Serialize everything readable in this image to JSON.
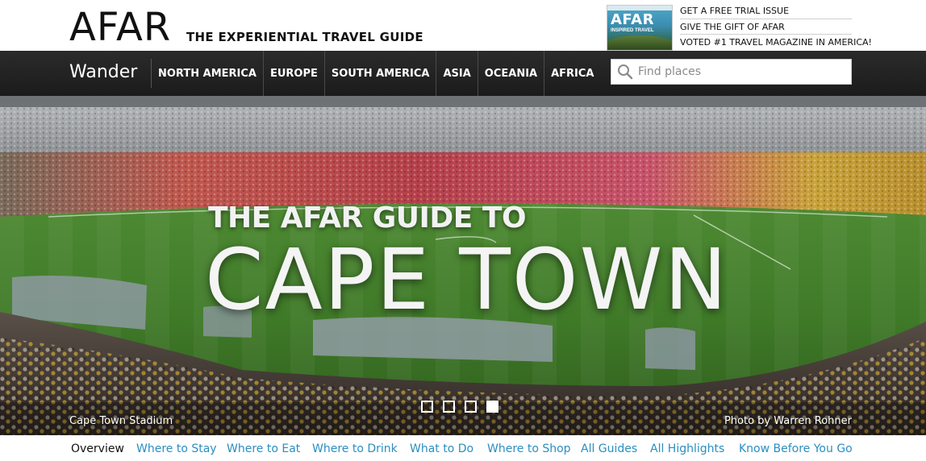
{
  "brand": {
    "logo": "AFAR",
    "tagline": "THE EXPERIENTIAL TRAVEL GUIDE",
    "magazine_logo": "AFAR",
    "magazine_sub": "INSPIRED TRAVEL"
  },
  "promos": [
    "GET A FREE TRIAL ISSUE",
    "GIVE THE GIFT OF AFAR",
    "VOTED #1 TRAVEL MAGAZINE IN AMERICA!"
  ],
  "nav": {
    "wander": "Wander",
    "regions": [
      "NORTH AMERICA",
      "EUROPE",
      "SOUTH AMERICA",
      "ASIA",
      "OCEANIA",
      "AFRICA"
    ],
    "search_placeholder": "Find places"
  },
  "hero": {
    "kicker": "THE AFAR GUIDE TO",
    "title": "CAPE TOWN",
    "caption_left": "Cape Town Stadium",
    "caption_right": "Photo by Warren Rohner",
    "slides": 4,
    "active_slide": 4
  },
  "subnav": [
    "Overview",
    "Where to Stay",
    "Where to Eat",
    "Where to Drink",
    "What to Do",
    "Where to Shop",
    "All Guides",
    "All Highlights",
    "Know Before You Go"
  ],
  "colors": {
    "nav_bg": "#222222",
    "link_blue": "#2a8fc1",
    "pitch_green": "#4c8a2e"
  },
  "icons": {
    "search": "search-icon"
  }
}
